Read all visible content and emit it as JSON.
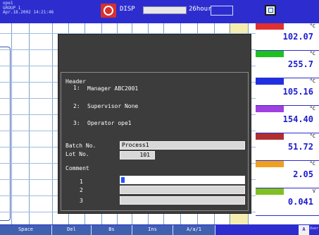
{
  "header": {
    "status_lines": [
      "ope1",
      "GROUP 1",
      "Apr.18.2002 14:21:46"
    ],
    "disp_label": "DISP",
    "timebase": "26hour"
  },
  "dialog": {
    "title": "Header",
    "header_lines": [
      {
        "num": "1:",
        "text": "Manager ABC2001"
      },
      {
        "num": "2:",
        "text": "Supervisor None"
      },
      {
        "num": "3:",
        "text": "Operator ope1"
      }
    ],
    "batch_label": "Batch No.",
    "batch_value": "Process1",
    "lot_label": "Lot No.",
    "lot_value": "101",
    "comment_label": "Comment",
    "comment_lines": [
      {
        "num": "1",
        "value": ""
      },
      {
        "num": "2",
        "value": ""
      },
      {
        "num": "3",
        "value": ""
      }
    ]
  },
  "channels": [
    {
      "color": "#e03030",
      "unit": "°C",
      "value": "102.07"
    },
    {
      "color": "#20c020",
      "unit": "°C",
      "value": "255.7"
    },
    {
      "color": "#2030e0",
      "unit": "°C",
      "value": "105.16"
    },
    {
      "color": "#a040e0",
      "unit": "°C",
      "value": "154.40"
    },
    {
      "color": "#b03030",
      "unit": "°C",
      "value": "51.72"
    },
    {
      "color": "#f0a020",
      "unit": "°C",
      "value": "2.05"
    },
    {
      "color": "#80c020",
      "unit": "V",
      "value": "0.041"
    }
  ],
  "softkeys": [
    "Space",
    "Del",
    "Bs",
    "Ins",
    "A/a/1"
  ],
  "mode_key": "A",
  "over_label": "Over",
  "colors": {
    "bar": "#2d2dcf",
    "value_text": "#1b1bd0",
    "dialog_bg": "#3c3c3c"
  },
  "icons": [
    "alarm-icon",
    "monitor-icon"
  ]
}
